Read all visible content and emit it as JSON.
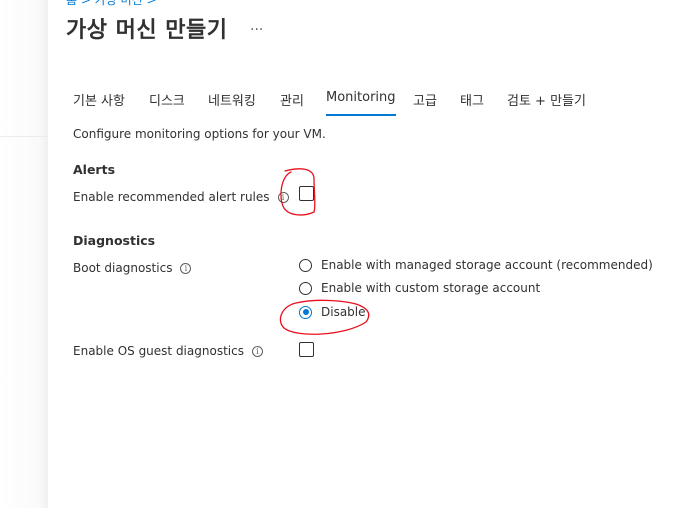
{
  "breadcrumb": "홈 > 가상 머신 >",
  "title": "가상 머신 만들기",
  "more": "...",
  "tabs": [
    {
      "label": "기본 사항",
      "active": false
    },
    {
      "label": "디스크",
      "active": false
    },
    {
      "label": "네트워킹",
      "active": false
    },
    {
      "label": "관리",
      "active": false
    },
    {
      "label": "Monitoring",
      "active": true
    },
    {
      "label": "고급",
      "active": false
    },
    {
      "label": "태그",
      "active": false
    },
    {
      "label": "검토 + 만들기",
      "active": false
    }
  ],
  "description": "Configure monitoring options for your VM.",
  "alerts": {
    "heading": "Alerts",
    "rule_label": "Enable recommended alert rules",
    "rule_checked": false
  },
  "diagnostics": {
    "heading": "Diagnostics",
    "boot_label": "Boot diagnostics",
    "options": [
      {
        "label": "Enable with managed storage account (recommended)",
        "checked": false
      },
      {
        "label": "Enable with custom storage account",
        "checked": false
      },
      {
        "label": "Disable",
        "checked": true
      }
    ],
    "os_guest_label": "Enable OS guest diagnostics",
    "os_guest_checked": false
  },
  "info_glyph": "i",
  "colors": {
    "accent": "#0078d4",
    "annotation": "#e8101e"
  }
}
